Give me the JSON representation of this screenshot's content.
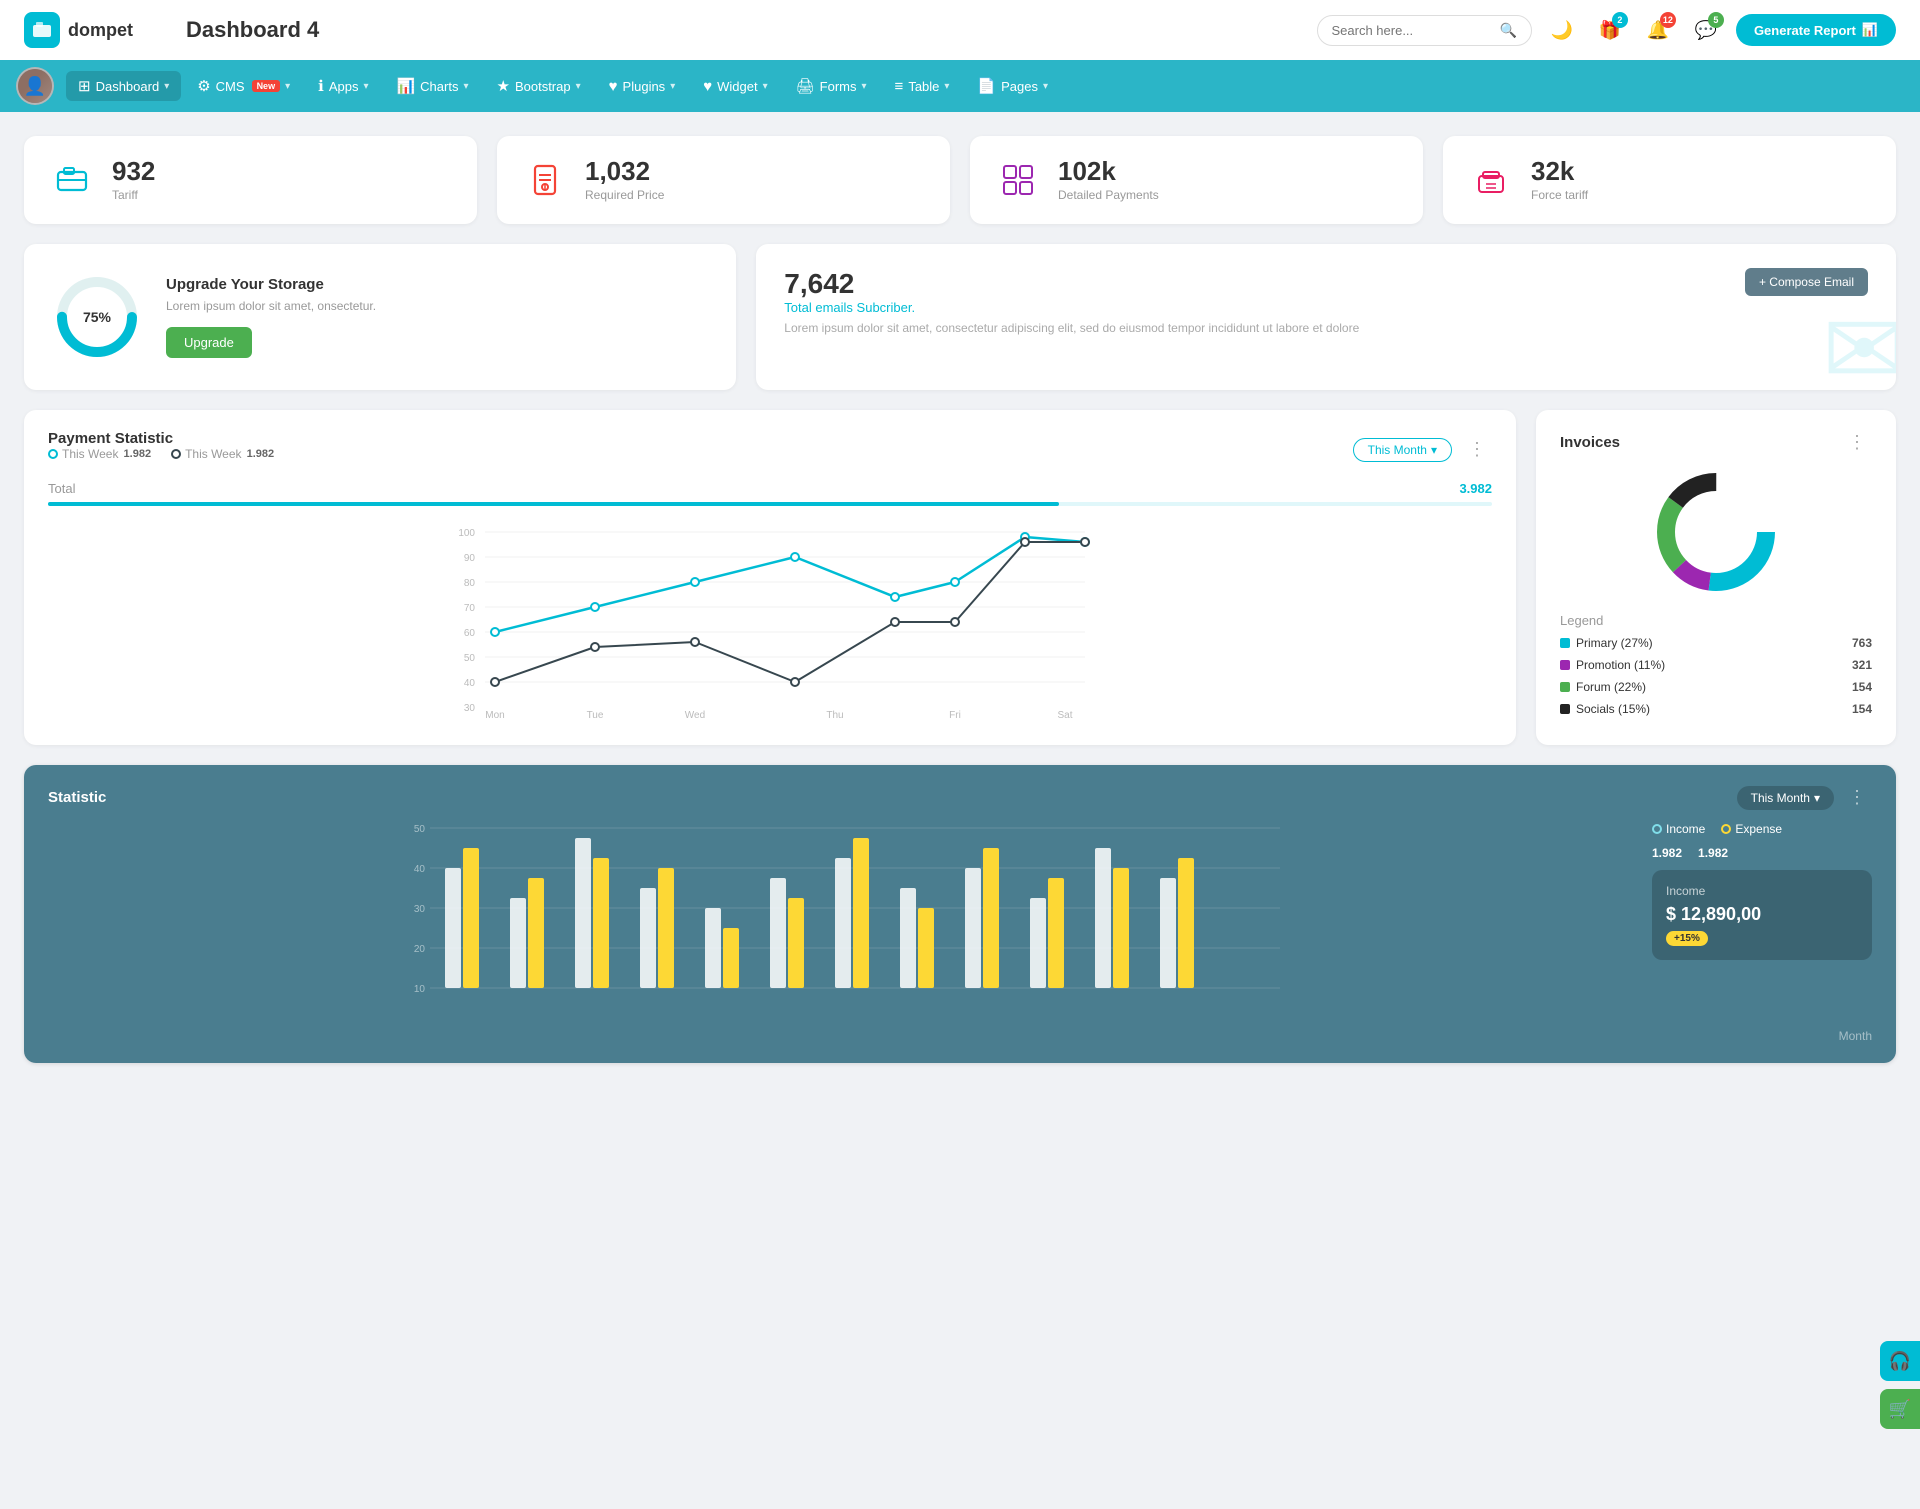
{
  "header": {
    "logo_text": "dompet",
    "page_title": "Dashboard 4",
    "search_placeholder": "Search here...",
    "generate_btn": "Generate Report",
    "icons": {
      "moon": "🌙",
      "gift": "🎁",
      "bell": "🔔",
      "chat": "💬"
    },
    "badges": {
      "gift": "2",
      "bell": "12",
      "chat": "5"
    }
  },
  "nav": {
    "items": [
      {
        "id": "dashboard",
        "label": "Dashboard",
        "icon": "⊞",
        "active": true,
        "badge": null
      },
      {
        "id": "cms",
        "label": "CMS",
        "icon": "⚙",
        "active": false,
        "badge": "New"
      },
      {
        "id": "apps",
        "label": "Apps",
        "icon": "ℹ",
        "active": false,
        "badge": null
      },
      {
        "id": "charts",
        "label": "Charts",
        "icon": "📊",
        "active": false,
        "badge": null
      },
      {
        "id": "bootstrap",
        "label": "Bootstrap",
        "icon": "★",
        "active": false,
        "badge": null
      },
      {
        "id": "plugins",
        "label": "Plugins",
        "icon": "♥",
        "active": false,
        "badge": null
      },
      {
        "id": "widget",
        "label": "Widget",
        "icon": "♥",
        "active": false,
        "badge": null
      },
      {
        "id": "forms",
        "label": "Forms",
        "icon": "🖨",
        "active": false,
        "badge": null
      },
      {
        "id": "table",
        "label": "Table",
        "icon": "≡",
        "active": false,
        "badge": null
      },
      {
        "id": "pages",
        "label": "Pages",
        "icon": "📄",
        "active": false,
        "badge": null
      }
    ]
  },
  "stats": [
    {
      "id": "tariff",
      "value": "932",
      "label": "Tariff",
      "icon": "briefcase",
      "color": "teal"
    },
    {
      "id": "required-price",
      "value": "1,032",
      "label": "Required Price",
      "icon": "file",
      "color": "red"
    },
    {
      "id": "detailed-payments",
      "value": "102k",
      "label": "Detailed Payments",
      "icon": "grid",
      "color": "purple"
    },
    {
      "id": "force-tariff",
      "value": "32k",
      "label": "Force tariff",
      "icon": "building",
      "color": "pink"
    }
  ],
  "storage": {
    "percent": "75%",
    "percent_num": 75,
    "title": "Upgrade Your Storage",
    "description": "Lorem ipsum dolor sit amet, onsectetur.",
    "btn_label": "Upgrade"
  },
  "email": {
    "count": "7,642",
    "subtitle": "Total emails Subcriber.",
    "description": "Lorem ipsum dolor sit amet, consectetur adipiscing elit, sed do eiusmod tempor incididunt ut labore et dolore",
    "compose_btn": "+ Compose Email"
  },
  "payment": {
    "title": "Payment Statistic",
    "legend1_label": "This Week",
    "legend1_value": "1.982",
    "legend2_label": "This Week",
    "legend2_value": "1.982",
    "filter_btn": "This Month",
    "total_label": "Total",
    "total_value": "3.982",
    "x_labels": [
      "Mon",
      "Tue",
      "Wed",
      "Thu",
      "Fri",
      "Sat"
    ],
    "y_labels": [
      "100",
      "90",
      "80",
      "70",
      "60",
      "50",
      "40",
      "30"
    ],
    "line1_points": "40,160 120,130 200,115 280,85 360,120 440,115 520,90 600,90",
    "line2_points": "40,140 120,120 200,130 280,140 360,100 440,100 520,85 600,90"
  },
  "invoices": {
    "title": "Invoices",
    "legend": [
      {
        "label": "Primary (27%)",
        "value": "763",
        "color": "#00bcd4"
      },
      {
        "label": "Promotion (11%)",
        "value": "321",
        "color": "#9c27b0"
      },
      {
        "label": "Forum (22%)",
        "value": "154",
        "color": "#4caf50"
      },
      {
        "label": "Socials (15%)",
        "value": "154",
        "color": "#333"
      }
    ],
    "legend_title": "Legend"
  },
  "statistic": {
    "title": "Statistic",
    "filter_btn": "This Month",
    "income_label": "Income",
    "income_value": "1.982",
    "expense_label": "Expense",
    "expense_value": "1.982",
    "income_detail_label": "Income",
    "income_detail_value": "$ 12,890,00",
    "income_badge": "+15%",
    "y_labels": [
      "50",
      "40",
      "30",
      "20",
      "10"
    ],
    "month_label": "Month"
  },
  "floating": {
    "headset_icon": "🎧",
    "cart_icon": "🛒"
  }
}
